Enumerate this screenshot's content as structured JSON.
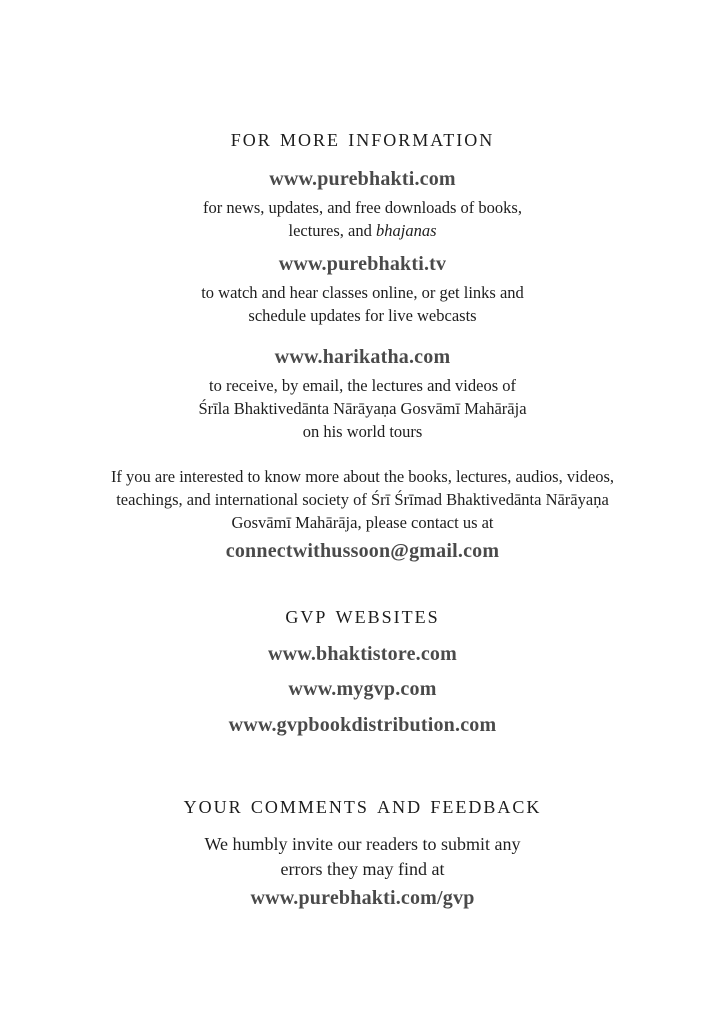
{
  "more_info": {
    "heading": "For More Information",
    "site1": {
      "url": "www.purebhakti.com",
      "desc_line1": "for news, updates, and free downloads of books,",
      "desc_line2_prefix": "lectures, and ",
      "desc_line2_italic": "bhajanas"
    },
    "site2": {
      "url": "www.purebhakti.tv",
      "desc_line1": "to watch and hear classes online, or get links and",
      "desc_line2": "schedule updates for live webcasts"
    },
    "site3": {
      "url": "www.harikatha.com",
      "desc_line1": "to receive, by email, the lectures and videos of",
      "desc_line2": "Śrīla Bhaktivedānta Nārāyaṇa Gosvāmī Mahārāja",
      "desc_line3": "on his world tours"
    },
    "contact": {
      "line1": "If you are interested to know more about the books, lectures, audios, videos,",
      "line2": "teachings, and international society of Śrī Śrīmad Bhaktivedānta Nārāyaṇa",
      "line3": "Gosvāmī Mahārāja, please contact us at",
      "email": "connectwithussoon@gmail.com"
    }
  },
  "gvp_websites": {
    "heading": "GVP Websites",
    "links": [
      "www.bhaktistore.com",
      "www.mygvp.com",
      "www.gvpbookdistribution.com"
    ]
  },
  "feedback": {
    "heading": "Your Comments and Feedback",
    "line1": "We humbly invite our readers to submit any",
    "line2": "errors they may find at",
    "url": "www.purebhakti.com/gvp"
  }
}
